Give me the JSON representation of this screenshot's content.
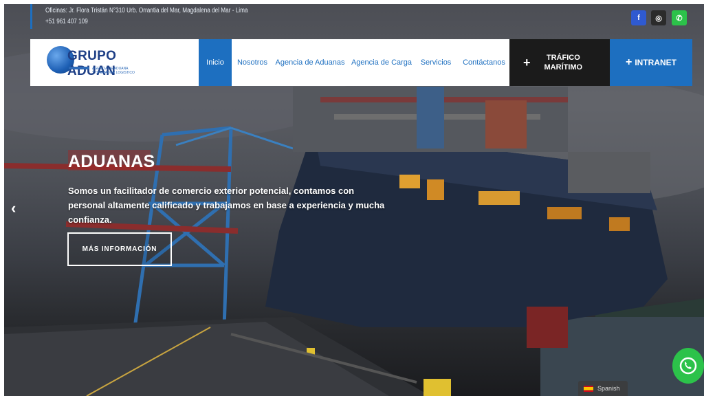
{
  "topbar": {
    "address": "Oficinas: Jr. Flora Tristán N°310 Urb. Orrantia del Mar, Magdalena del Mar - Lima",
    "phone": "+51 961 407 109"
  },
  "social": [
    {
      "icon": "facebook-icon",
      "glyph": "f"
    },
    {
      "icon": "instagram-icon",
      "glyph": "◎"
    },
    {
      "icon": "whatsapp-icon",
      "glyph": "✆"
    }
  ],
  "logo": {
    "name": "GRUPO ADUAN",
    "subtitle_1": "AGENCIA DE ADUANA",
    "subtitle_2": "Y OPERADOR LOGISTICO"
  },
  "nav": {
    "items": [
      {
        "label": "Inicio",
        "active": true
      },
      {
        "label": "Nosotros"
      },
      {
        "label": "Agencia de Aduanas"
      },
      {
        "label": "Agencia de Carga"
      },
      {
        "label": "Servicios"
      },
      {
        "label": "Contáctanos"
      }
    ],
    "trafico_line1": "TRÁFICO",
    "trafico_line2": "MARÍTIMO",
    "intranet": "INTRANET",
    "plus": "+"
  },
  "slide": {
    "title": "ADUANAS",
    "description": "Somos un facilitador de comercio exterior potencial, contamos con personal altamente calificado y trabajamos en base a experiencia y mucha confianza.",
    "button": "MÁS INFORMACIÓN"
  },
  "carousel": {
    "prev_glyph": "‹"
  },
  "language": {
    "label": "Spanish"
  },
  "colors": {
    "brand_blue": "#1d6fc0",
    "dark": "#1b1b1b",
    "whatsapp": "#2cc24a"
  }
}
